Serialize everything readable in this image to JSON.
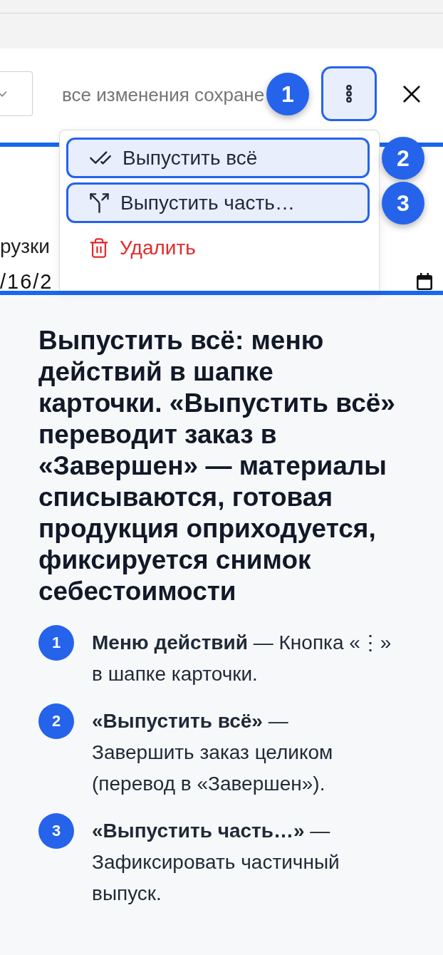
{
  "header": {
    "status_text": "все изменения сохране",
    "callout": "1",
    "more_button": {
      "highlighted": true
    }
  },
  "form": {
    "field_label": "рузки",
    "date_value": "/16/2"
  },
  "actions_menu": {
    "items": [
      {
        "kind": "done",
        "label": "Выпустить всё",
        "highlighted": true,
        "callout": "2"
      },
      {
        "kind": "split",
        "label": "Выпустить часть…",
        "highlighted": true,
        "callout": "3"
      },
      {
        "kind": "delete",
        "label": "Удалить",
        "highlighted": false
      }
    ]
  },
  "explanation": {
    "title": "Выпустить всё: меню действий в шапке карточки. «Выпустить всё» переводит заказ в «Завершен» — материалы списываются, готовая продукция оприходуется, фиксируется снимок себестоимости",
    "steps": [
      {
        "number": "1",
        "text": "**Меню действий** — Кнопка «⋮» в шапке карточки."
      },
      {
        "number": "2",
        "text": "**«Выпустить всё»** — Завершить заказ целиком (перевод в «Завершен»)."
      },
      {
        "number": "3",
        "text": "**«Выпустить часть…»** — Зафиксировать частичный выпуск."
      }
    ]
  }
}
